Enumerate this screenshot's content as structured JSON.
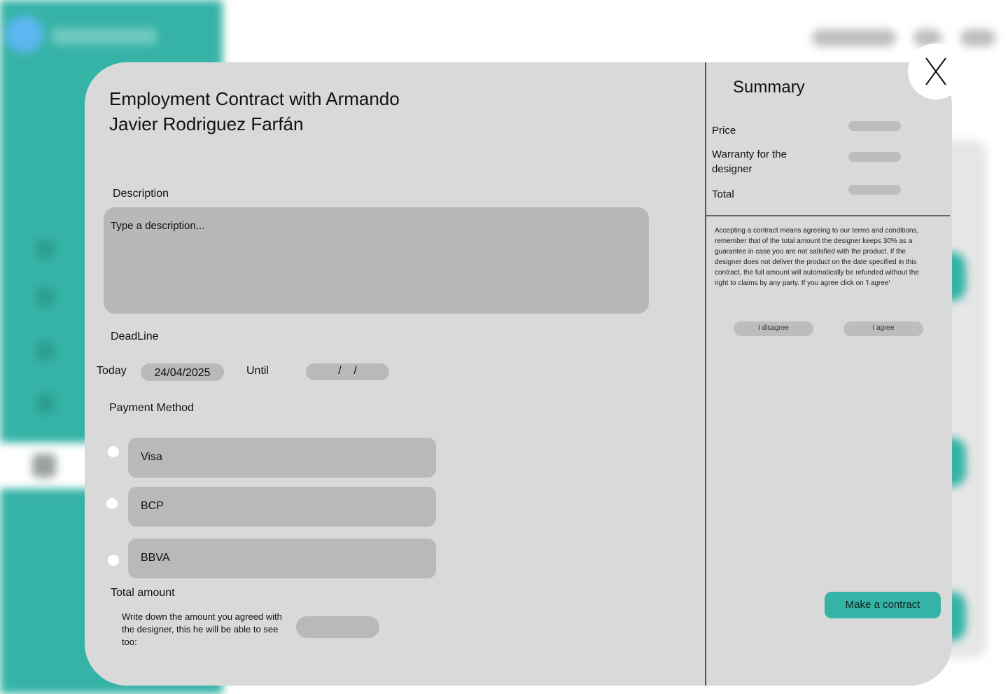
{
  "modal": {
    "title": "Employment Contract with Armando Javier Rodriguez Farfán",
    "description": {
      "label": "Description",
      "placeholder": "Type a description..."
    },
    "deadline": {
      "label": "DeadLine",
      "today_label": "Today",
      "today_value": "24/04/2025",
      "until_label": "Until",
      "until_value": "/    /"
    },
    "payment": {
      "label": "Payment Method",
      "options": [
        "Visa",
        "BCP",
        "BBVA"
      ]
    },
    "total": {
      "label": "Total amount",
      "hint": "Write down the amount you agreed with the designer, this he will be able to see too:"
    }
  },
  "summary": {
    "title": "Summary",
    "rows": [
      "Price",
      "Warranty for the designer",
      "Total"
    ],
    "terms": "Accepting a contract means agreeing to our terms and conditions, remember that of the total amount the designer keeps 30% as a guarantee in case you are not satisfied with the product. If the designer does not deliver the product on the date specified in this contract, the full amount will automatically be refunded without the right to claims by any party. If you agree click on 'I agree'",
    "disagree_label": "I disagree",
    "agree_label": "I agree",
    "make_contract_label": "Make a contract"
  },
  "colors": {
    "accent": "#35b3a6",
    "modal_bg": "#d9d9d9",
    "field_bg": "#b9b9b9"
  },
  "icons": {
    "close": "close-icon"
  }
}
